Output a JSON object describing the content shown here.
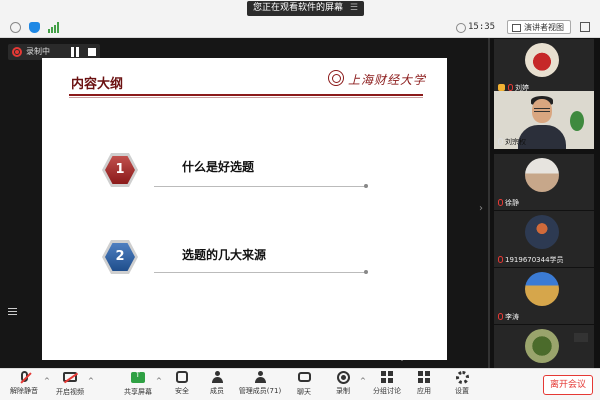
{
  "topbar": {
    "share_banner": "您正在观看软件的屏幕",
    "share_menu": "☰",
    "timer": "15:35",
    "view_toggle": "演讲者视图"
  },
  "recording": {
    "label": "录制中"
  },
  "slide": {
    "title": "内容大纲",
    "university_name": "上海财经大学",
    "items": [
      {
        "number": "1",
        "text": "什么是好选题"
      },
      {
        "number": "2",
        "text": "选题的几大来源"
      }
    ]
  },
  "gallery": {
    "participants": [
      {
        "name": "刘婷"
      },
      {
        "name": "刘宗权"
      },
      {
        "name": "徐静"
      },
      {
        "name": "1919670344学员"
      },
      {
        "name": "李涛"
      },
      {
        "name": ""
      }
    ]
  },
  "toolbar": {
    "mute": "解除静音",
    "video": "开启视频",
    "share": "共享屏幕",
    "security": "安全",
    "participants": "成员",
    "manage": "管理成员(71)",
    "chat": "聊天",
    "record": "录制",
    "collab": "分组讨论",
    "apps": "应用",
    "settings": "设置",
    "leave": "离开会议"
  },
  "colors": {
    "accent_red": "#8b1a1a",
    "share_green": "#2ea043",
    "leave_red": "#e53935"
  }
}
